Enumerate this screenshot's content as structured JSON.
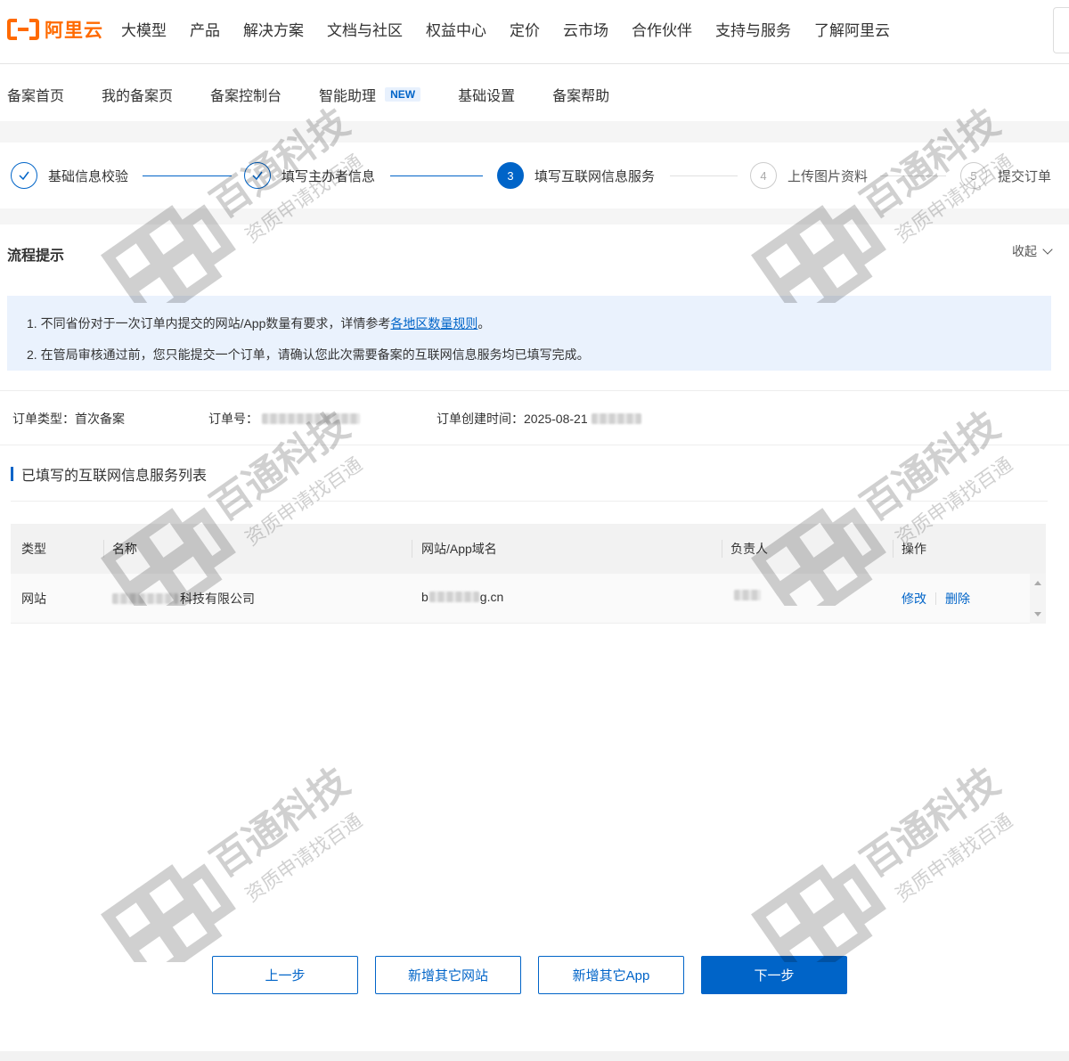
{
  "topnav": {
    "logo_text": "阿里云",
    "items": [
      "大模型",
      "产品",
      "解决方案",
      "文档与社区",
      "权益中心",
      "定价",
      "云市场",
      "合作伙伴",
      "支持与服务",
      "了解阿里云"
    ]
  },
  "subnav": {
    "items": [
      "备案首页",
      "我的备案页",
      "备案控制台",
      "智能助理",
      "基础设置",
      "备案帮助"
    ],
    "new_badge": "NEW"
  },
  "steps": [
    {
      "label": "基础信息校验",
      "state": "done",
      "number": ""
    },
    {
      "label": "填写主办者信息",
      "state": "done",
      "number": ""
    },
    {
      "label": "填写互联网信息服务",
      "state": "active",
      "number": "3"
    },
    {
      "label": "上传图片资料",
      "state": "todo",
      "number": "4"
    },
    {
      "label": "提交订单",
      "state": "todo",
      "number": "5"
    }
  ],
  "tips": {
    "title": "流程提示",
    "collapse_label": "收起",
    "line1_prefix": "1. 不同省份对于一次订单内提交的网站/App数量有要求，详情参考",
    "line1_link": "各地区数量规则",
    "line1_suffix": "。",
    "line2": "2. 在管局审核通过前，您只能提交一个订单，请确认您此次需要备案的互联网信息服务均已填写完成。"
  },
  "order": {
    "type_label": "订单类型：首次备案",
    "number_label": "订单号：",
    "created_label": "订单创建时间：2025-08-21"
  },
  "list": {
    "title": "已填写的互联网信息服务列表",
    "headers": [
      "类型",
      "名称",
      "网站/App域名",
      "负责人",
      "操作"
    ],
    "rows": [
      {
        "type": "网站",
        "name_suffix": "科技有限公司",
        "domain_prefix": "b",
        "domain_suffix": "g.cn",
        "edit": "修改",
        "delete": "删除"
      }
    ]
  },
  "buttons": {
    "prev": "上一步",
    "add_site": "新增其它网站",
    "add_app": "新增其它App",
    "next": "下一步"
  },
  "watermark": {
    "main": "百通科技",
    "sub": "资质申请找百通"
  },
  "colors": {
    "brand": "#ff6a00",
    "primary": "#0064c8",
    "tips_bg": "#eaf2fd"
  }
}
